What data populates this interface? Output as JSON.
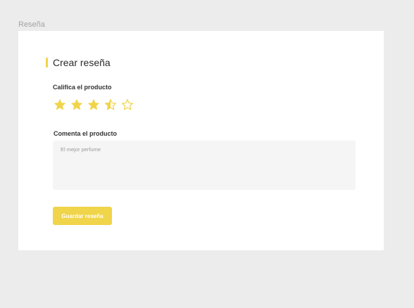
{
  "frame": {
    "label": "Reseña"
  },
  "form": {
    "title": "Crear reseña",
    "rating_label": "Califica el producto",
    "rating_value": 3.5,
    "rating_max": 5,
    "comment_label": "Comenta el producto",
    "comment_placeholder": "El mejor perfume",
    "save_label": "Guardar reseña"
  },
  "stars": [
    {
      "state": "full",
      "icon": "star-filled-icon"
    },
    {
      "state": "full",
      "icon": "star-filled-icon"
    },
    {
      "state": "full",
      "icon": "star-filled-icon"
    },
    {
      "state": "half",
      "icon": "star-half-icon"
    },
    {
      "state": "empty",
      "icon": "star-empty-icon"
    }
  ],
  "colors": {
    "accent": "#f0d44a",
    "background": "#ececec",
    "card": "#ffffff",
    "input_background": "#f5f5f5",
    "title_text": "#2a2a2a"
  }
}
